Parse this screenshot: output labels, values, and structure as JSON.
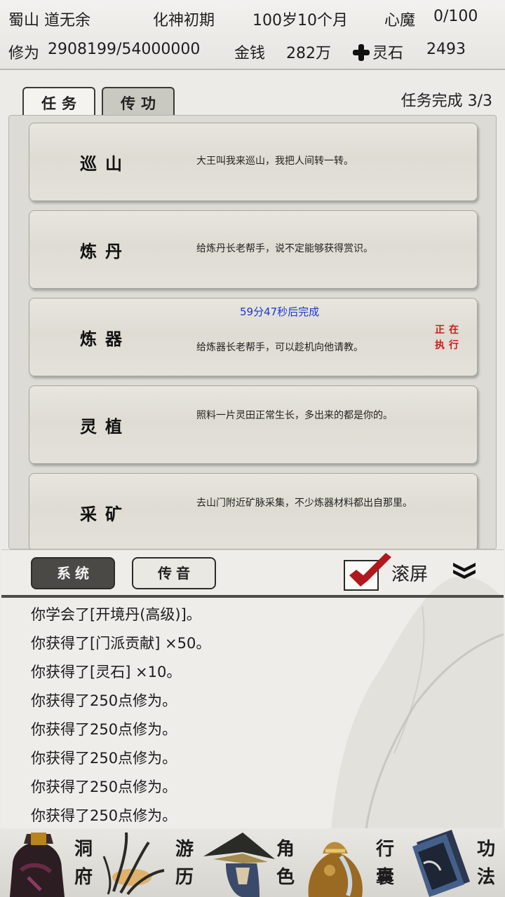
{
  "status_bar": {
    "location": "蜀山 道无余",
    "realm": "化神初期",
    "age": "100岁10个月",
    "demon_label": "心魔",
    "demon_value": "0/100",
    "cultivation_label": "修为",
    "cultivation_value": "2908199/54000000",
    "money_label": "金钱",
    "money_value": "282万",
    "spirit_stone_label": "灵石",
    "spirit_stone_value": "2493"
  },
  "tabs": [
    {
      "label": "任务",
      "active": true
    },
    {
      "label": "传功",
      "active": false
    }
  ],
  "task_progress": "任务完成 3/3",
  "tasks": [
    {
      "title": "巡山",
      "desc": "大王叫我来巡山，我把人间转一转。"
    },
    {
      "title": "炼丹",
      "desc": "给炼丹长老帮手，说不定能够获得赏识。"
    },
    {
      "title": "炼器",
      "desc": "给炼器长老帮手，可以趁机向他请教。",
      "timer": "59分47秒后完成",
      "status_line1": "正在",
      "status_line2": "执行"
    },
    {
      "title": "灵植",
      "desc": "照料一片灵田正常生长，多出来的都是你的。"
    },
    {
      "title": "采矿",
      "desc": "去山门附近矿脉采集，不少炼器材料都出自那里。"
    }
  ],
  "log": {
    "tabs": [
      {
        "label": "系统",
        "active": true
      },
      {
        "label": "传音",
        "active": false
      }
    ],
    "scroll_label": "滚屏",
    "scroll_checked": true,
    "lines": [
      "你学会了[开境丹(高级)]。",
      "你获得了[门派贡献] ×50。",
      "你获得了[灵石] ×10。",
      "你获得了250点修为。",
      "你获得了250点修为。",
      "你获得了250点修为。",
      "你获得了250点修为。",
      "你获得了250点修为。"
    ]
  },
  "nav": [
    {
      "l1": "洞",
      "l2": "府",
      "icon": "cave-dwelling-icon"
    },
    {
      "l1": "游",
      "l2": "历",
      "icon": "travel-hat-icon"
    },
    {
      "l1": "角",
      "l2": "色",
      "icon": "character-icon"
    },
    {
      "l1": "行",
      "l2": "囊",
      "icon": "bag-icon"
    },
    {
      "l1": "功",
      "l2": "法",
      "icon": "book-icon"
    }
  ],
  "colors": {
    "timer_blue": "#1d37c9",
    "status_red": "#d21a1a",
    "check_red": "#b0181e"
  }
}
